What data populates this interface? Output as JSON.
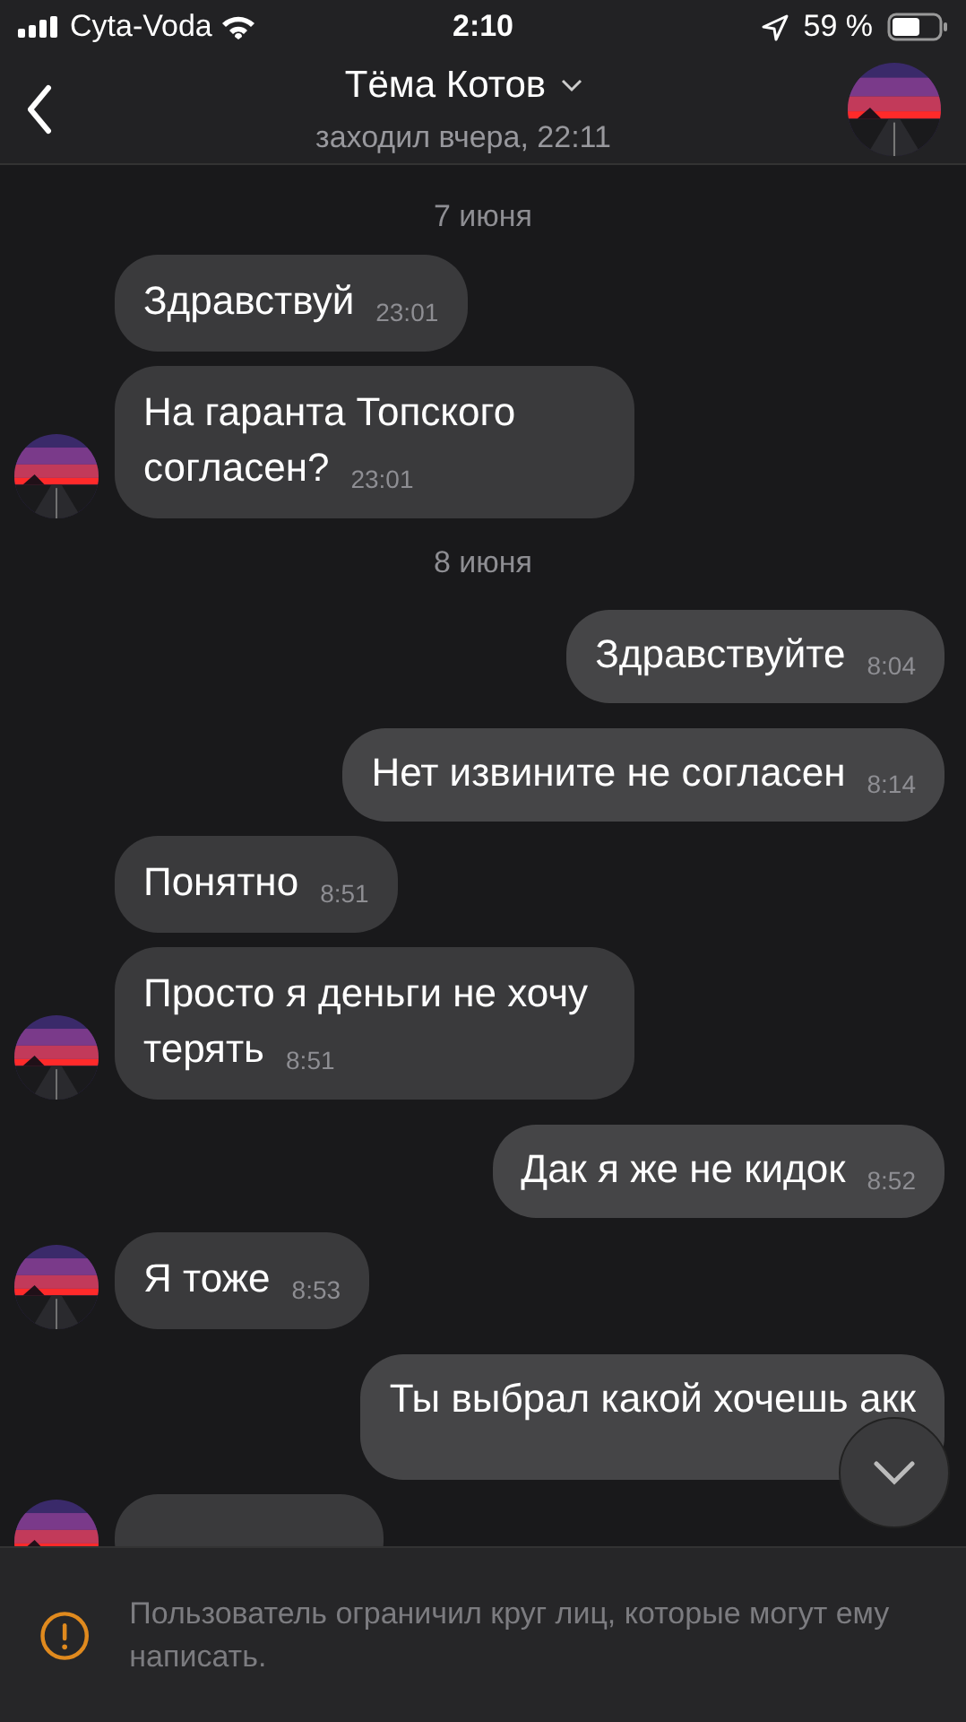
{
  "status_bar": {
    "carrier": "Cyta-Voda",
    "time": "2:10",
    "battery": "59 %"
  },
  "header": {
    "name": "Тёма Котов",
    "last_seen": "заходил вчера, 22:11"
  },
  "messages": [
    {
      "kind": "date",
      "text": "7 июня"
    },
    {
      "kind": "incoming",
      "text": "Здравствуй",
      "time": "23:01",
      "avatar": false
    },
    {
      "kind": "incoming",
      "text": "На гаранта Топского согласен?",
      "time": "23:01",
      "avatar": true
    },
    {
      "kind": "date",
      "text": "8 июня"
    },
    {
      "kind": "outgoing",
      "text": "Здравствуйте",
      "time": "8:04"
    },
    {
      "kind": "outgoing",
      "text": "Нет извините не согласен",
      "time": "8:14"
    },
    {
      "kind": "incoming",
      "text": "Понятно",
      "time": "8:51",
      "avatar": false
    },
    {
      "kind": "incoming",
      "text": "Просто я деньги не хочу терять",
      "time": "8:51",
      "avatar": true
    },
    {
      "kind": "outgoing",
      "text": "Дак я же не кидок",
      "time": "8:52"
    },
    {
      "kind": "incoming",
      "text": "Я тоже",
      "time": "8:53",
      "avatar": true
    },
    {
      "kind": "outgoing",
      "text": "Ты выбрал какой хочешь акк"
    },
    {
      "kind": "cut",
      "avatar": true
    }
  ],
  "notice": "Пользователь ограничил круг лиц, которые могут ему написать."
}
